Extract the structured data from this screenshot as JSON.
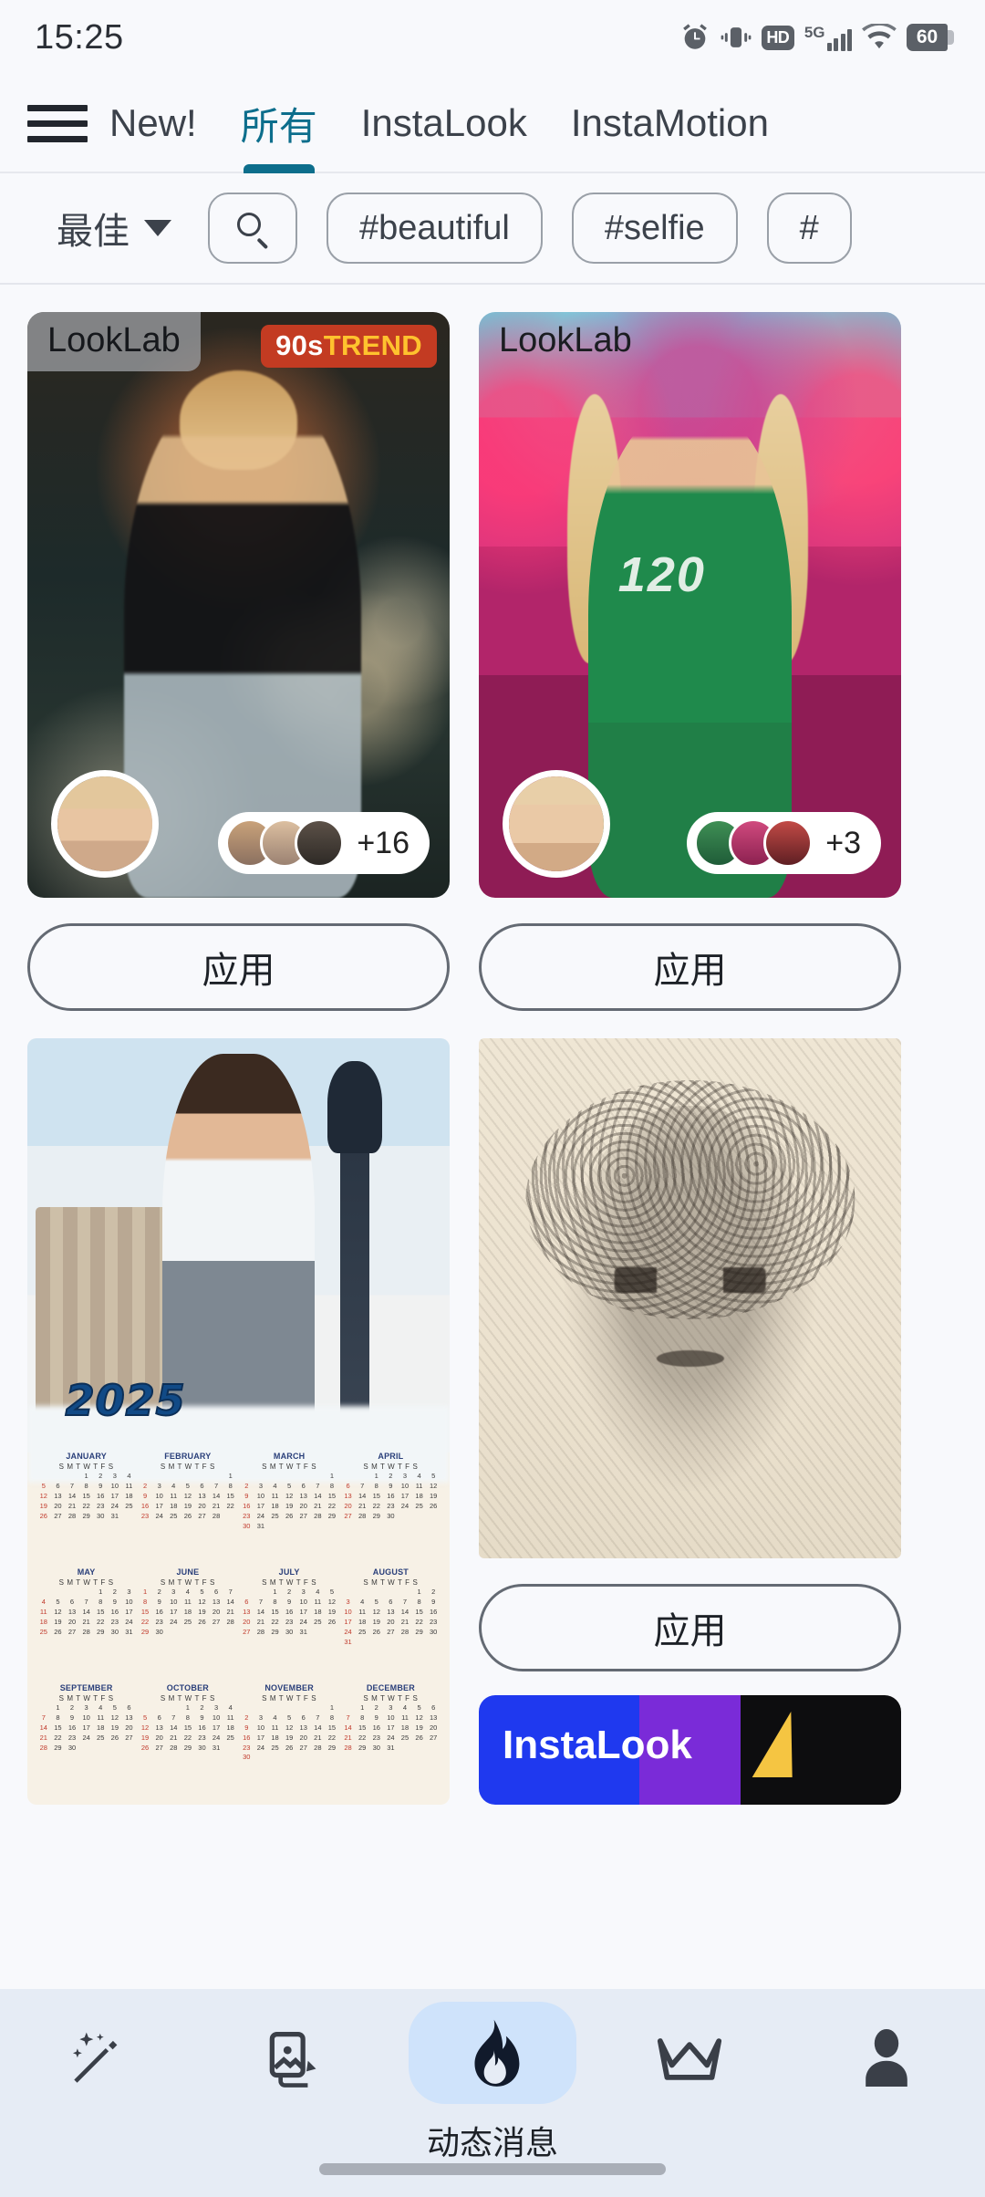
{
  "status_bar": {
    "time": "15:25",
    "battery_level": "60",
    "network": "5G",
    "hd_badge": "HD",
    "icons": [
      "alarm-icon",
      "vibrate-icon",
      "hd-icon",
      "5g-signal-icon",
      "wifi-icon",
      "battery-icon"
    ]
  },
  "top_tabs": {
    "menu_icon": "hamburger-menu-icon",
    "items": [
      {
        "label": "New!",
        "active": false
      },
      {
        "label": "所有",
        "active": true
      },
      {
        "label": "InstaLook",
        "active": false
      },
      {
        "label": "InstaMotion",
        "active": false
      }
    ],
    "active_color": "#0d6e8c"
  },
  "filter_bar": {
    "sort": {
      "label": "最佳",
      "icon": "chevron-down-icon"
    },
    "search_icon": "search-icon",
    "chips": [
      {
        "label": "#beautiful"
      },
      {
        "label": "#selfie"
      },
      {
        "label": "#"
      }
    ]
  },
  "feed": {
    "cards": [
      {
        "brand_badge": "LookLab",
        "trend_badge": {
          "prefix": "90s",
          "suffix": "TREND"
        },
        "more_count": "+16",
        "apply_label": "应用",
        "image_name": "street-fashion-leather-jacket-photo"
      },
      {
        "brand_badge": "LookLab",
        "more_count": "+3",
        "apply_label": "应用",
        "image_name": "green-tracksuit-squid-game-photo"
      },
      {
        "year": "2025",
        "image_name": "calendar-2025-child-snow-photo",
        "months": [
          {
            "name": "JANUARY",
            "start": 3,
            "days": 31
          },
          {
            "name": "FEBRUARY",
            "start": 6,
            "days": 28
          },
          {
            "name": "MARCH",
            "start": 6,
            "days": 31
          },
          {
            "name": "APRIL",
            "start": 2,
            "days": 30
          },
          {
            "name": "MAY",
            "start": 4,
            "days": 31
          },
          {
            "name": "JUNE",
            "start": 0,
            "days": 30
          },
          {
            "name": "JULY",
            "start": 2,
            "days": 31
          },
          {
            "name": "AUGUST",
            "start": 5,
            "days": 31
          },
          {
            "name": "SEPTEMBER",
            "start": 1,
            "days": 30
          },
          {
            "name": "OCTOBER",
            "start": 3,
            "days": 31
          },
          {
            "name": "NOVEMBER",
            "start": 6,
            "days": 30
          },
          {
            "name": "DECEMBER",
            "start": 1,
            "days": 31
          }
        ],
        "dow": "S M T W T F S"
      },
      {
        "apply_label": "应用",
        "image_name": "pencil-sketch-portrait-photo",
        "promo_label": "InstaLook"
      }
    ]
  },
  "bottom_nav": {
    "items": [
      {
        "icon": "magic-wand-icon",
        "label": "",
        "active": false
      },
      {
        "icon": "photo-edit-icon",
        "label": "",
        "active": false
      },
      {
        "icon": "flame-icon",
        "label": "动态消息",
        "active": true
      },
      {
        "icon": "crown-icon",
        "label": "",
        "active": false
      },
      {
        "icon": "person-icon",
        "label": "",
        "active": false
      }
    ],
    "active_pill_color": "#cfe3fb",
    "background_color": "#e6ecf5"
  }
}
